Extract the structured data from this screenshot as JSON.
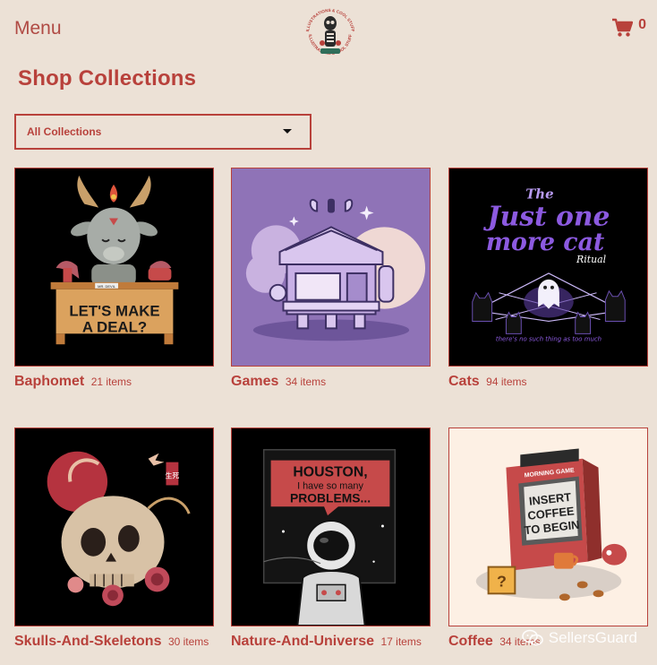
{
  "header": {
    "menu_label": "Menu",
    "cart_count": "0",
    "logo_text_top": "ILLUSTRATIONS & COOL STUFF",
    "logo_text_bottom": "ILLUSTRATIONS & COOL STUFF"
  },
  "page_title": "Shop Collections",
  "filter": {
    "selected": "All Collections"
  },
  "collections": [
    {
      "name": "Baphomet",
      "count": "21 items",
      "art": {
        "headline": "LET'S MAKE",
        "headline2": "A DEAL?",
        "sign": "MR. DEVIL"
      }
    },
    {
      "name": "Games",
      "count": "34 items"
    },
    {
      "name": "Cats",
      "count": "94 items",
      "art": {
        "line1": "The",
        "line2": "Just one",
        "line3": "more cat",
        "line4": "Ritual",
        "footer": "there's no such thing as too much"
      }
    },
    {
      "name": "Skulls-And-Skeletons",
      "count": "30 items",
      "art": {
        "stamp": "生死"
      }
    },
    {
      "name": "Nature-And-Universe",
      "count": "17 items",
      "art": {
        "line1": "HOUSTON,",
        "line2": "I have so many",
        "line3": "PROBLEMS..."
      }
    },
    {
      "name": "Coffee",
      "count": "34 items",
      "art": {
        "marquee": "MORNING GAME",
        "line1": "INSERT",
        "line2": "COFFEE",
        "line3": "TO BEGIN",
        "block": "?"
      }
    }
  ],
  "watermark": {
    "text": "SellersGuard"
  },
  "colors": {
    "background": "#ece1d6",
    "accent": "#b8413b",
    "games_bg": "#8f73b7"
  },
  "icons": {
    "cart": "shopping-cart-icon",
    "caret": "caret-down-icon",
    "watermark": "wechat-icon"
  }
}
